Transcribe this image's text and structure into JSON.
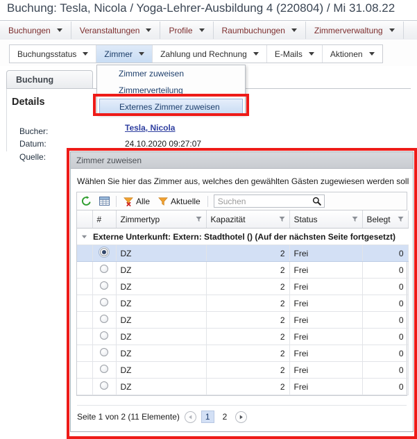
{
  "window": {
    "title": "Buchung: Tesla, Nicola / Yoga-Lehrer-Ausbildung 4 (220804) / Mi 31.08.22"
  },
  "menubar": {
    "items": [
      {
        "label": "Buchungen"
      },
      {
        "label": "Veranstaltungen"
      },
      {
        "label": "Profile"
      },
      {
        "label": "Raumbuchungen"
      },
      {
        "label": "Zimmerverwaltung"
      }
    ]
  },
  "toolbar2": {
    "items": [
      {
        "label": "Buchungsstatus",
        "active": false
      },
      {
        "label": "Zimmer",
        "active": true
      },
      {
        "label": "Zahlung und Rechnung",
        "active": false
      },
      {
        "label": "E-Mails",
        "active": false
      },
      {
        "label": "Aktionen",
        "active": false
      }
    ]
  },
  "dropdown": {
    "items": [
      {
        "label": "Zimmer zuweisen",
        "selected": false
      },
      {
        "label": "Zimmerverteilung",
        "selected": false
      },
      {
        "label": "Externes Zimmer zuweisen",
        "selected": true
      }
    ]
  },
  "content": {
    "tab_label": "Buchung",
    "details_heading": "Details",
    "fields": [
      {
        "label": "Bucher:",
        "value": "Tesla, Nicola",
        "is_link": true
      },
      {
        "label": "Datum:",
        "value": "24.10.2020 09:27:07",
        "is_link": false
      },
      {
        "label": "Quelle:",
        "value": "",
        "is_link": false
      }
    ]
  },
  "dialog": {
    "title": "Zimmer zuweisen",
    "instruction": "Wählen Sie hier das Zimmer aus, welches den gewählten Gästen zugewiesen werden soll",
    "toolbar": {
      "refresh_label": "refresh-icon",
      "columns_label": "columns-icon",
      "clear_filter_label": "Alle",
      "current_filter_label": "Aktuelle",
      "search_placeholder": "Suchen"
    },
    "grid": {
      "columns": [
        "#",
        "Zimmertyp",
        "Kapazität",
        "Status",
        "Belegt"
      ],
      "group_row": "Externe Unterkunft: Extern: Stadthotel () (Auf der nächsten Seite fortgesetzt)",
      "rows": [
        {
          "zimmertyp": "DZ",
          "kapazitaet": "2",
          "status": "Frei",
          "belegt": "0",
          "selected": true
        },
        {
          "zimmertyp": "DZ",
          "kapazitaet": "2",
          "status": "Frei",
          "belegt": "0",
          "selected": false
        },
        {
          "zimmertyp": "DZ",
          "kapazitaet": "2",
          "status": "Frei",
          "belegt": "0",
          "selected": false
        },
        {
          "zimmertyp": "DZ",
          "kapazitaet": "2",
          "status": "Frei",
          "belegt": "0",
          "selected": false
        },
        {
          "zimmertyp": "DZ",
          "kapazitaet": "2",
          "status": "Frei",
          "belegt": "0",
          "selected": false
        },
        {
          "zimmertyp": "DZ",
          "kapazitaet": "2",
          "status": "Frei",
          "belegt": "0",
          "selected": false
        },
        {
          "zimmertyp": "DZ",
          "kapazitaet": "2",
          "status": "Frei",
          "belegt": "0",
          "selected": false
        },
        {
          "zimmertyp": "DZ",
          "kapazitaet": "2",
          "status": "Frei",
          "belegt": "0",
          "selected": false
        },
        {
          "zimmertyp": "DZ",
          "kapazitaet": "2",
          "status": "Frei",
          "belegt": "0",
          "selected": false
        }
      ]
    },
    "pagination": {
      "summary": "Seite 1 von 2 (11 Elemente)",
      "pages": [
        "1",
        "2"
      ],
      "current_page": "1"
    }
  },
  "annotations": {
    "highlight_color": "#ee1b18"
  },
  "colors": {
    "menu_text": "#7c2d2d",
    "selection": "#d3e0f5",
    "accent": "#2f3fa0"
  }
}
